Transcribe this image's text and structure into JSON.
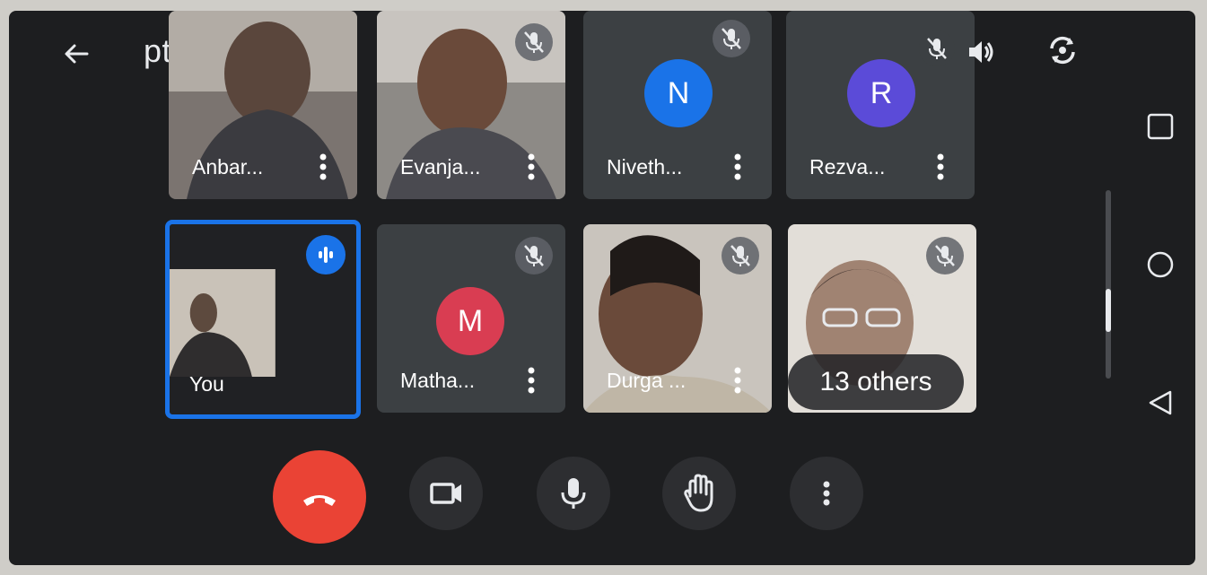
{
  "meeting": {
    "code": "ptg-idvx-nxw"
  },
  "participants": [
    {
      "name": "Anbar...",
      "type": "video"
    },
    {
      "name": "Evanja...",
      "type": "video",
      "muted": true
    },
    {
      "name": "Niveth...",
      "initial": "N",
      "color": "#1a73e8",
      "muted": true
    },
    {
      "name": "Rezva...",
      "initial": "R",
      "color": "#5b4bd8"
    },
    {
      "name": "You",
      "self": true,
      "speaking": true
    },
    {
      "name": "Matha...",
      "initial": "M",
      "color": "#d93d52",
      "muted": true
    },
    {
      "name": "Durga ...",
      "type": "video",
      "muted": true
    },
    {
      "others_label": "13 others",
      "type": "video",
      "muted": true
    }
  ],
  "controls": {
    "end_call": "end-call-icon",
    "camera": "video-camera-icon",
    "mic": "microphone-icon",
    "raise_hand": "raise-hand-icon",
    "more": "more-vert-icon"
  },
  "system_nav": {
    "recents": "square-icon",
    "home": "circle-icon",
    "back": "triangle-back-icon"
  },
  "colors": {
    "background": "#1d1e20",
    "tile": "#3c4043",
    "accent": "#1a73e8",
    "end_call": "#ea4335"
  }
}
